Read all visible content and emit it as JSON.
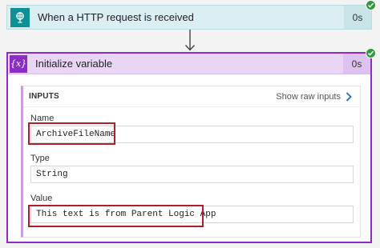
{
  "trigger": {
    "title": "When a HTTP request is received",
    "duration": "0s",
    "status": "succeeded",
    "icon": "http-request-icon"
  },
  "action": {
    "title": "Initialize variable",
    "duration": "0s",
    "status": "succeeded",
    "icon_text": "{x}",
    "inputs_label": "INPUTS",
    "raw_link_label": "Show raw inputs",
    "fields": [
      {
        "label": "Name",
        "value": "ArchiveFileName",
        "highlighted": true
      },
      {
        "label": "Type",
        "value": "String",
        "highlighted": false
      },
      {
        "label": "Value",
        "value": "This text is from Parent Logic App",
        "highlighted": true
      }
    ]
  },
  "colors": {
    "trigger_bg": "#dbeef1",
    "trigger_accent": "#0f8f96",
    "action_border": "#8b2cc7",
    "action_header_bg": "#e9d6f5",
    "success": "#2e9a3b",
    "highlight": "#b01e2a"
  }
}
